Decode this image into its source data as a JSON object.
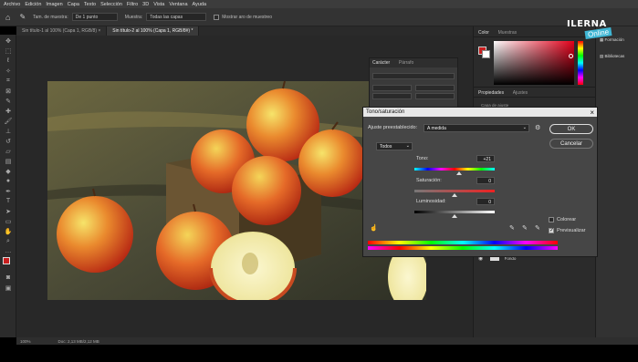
{
  "menubar": {
    "items": [
      "Archivo",
      "Edición",
      "Imagen",
      "Capa",
      "Texto",
      "Selección",
      "Filtro",
      "3D",
      "Vista",
      "Ventana",
      "Ayuda"
    ]
  },
  "options": {
    "sample_size_label": "Tam. de muestra:",
    "sample_size_value": "De 1 punto",
    "sample_label": "Muestra:",
    "sample_value": "Todas las capas",
    "show_ring_label": "Mostrar aro de muestreo"
  },
  "tabs": [
    {
      "label": "Sin título-1 al 100% (Capa 1, RGB/8) ×"
    },
    {
      "label": "Sin título-2 al 100% (Capa 1, RGB/8#) *"
    }
  ],
  "status": {
    "zoom": "100%",
    "doc": "Doc: 2,13 MB/2,12 MB"
  },
  "right_dock": {
    "color_tab": "Color",
    "swatches_tab": "Muestras",
    "properties_tab": "Propiedades",
    "adjustments_tab": "Ajustes",
    "adj_row": "Capa de ajuste",
    "layer_name": "Fondo"
  },
  "far_right": {
    "item1": "Formación",
    "item2": "Bibliotecas"
  },
  "logo": {
    "line1": "ILERNA",
    "line2": "Online"
  },
  "char_panel": {
    "tab1": "Carácter",
    "tab2": "Párrafo"
  },
  "dialog": {
    "title": "Tono/saturación",
    "close": "×",
    "preset_label": "Ajuste preestablecido:",
    "preset_value": "A medida",
    "channel_value": "Todos",
    "hue_label": "Tono:",
    "hue_value": "+21",
    "saturation_label": "Saturación:",
    "saturation_value": "0",
    "lightness_label": "Luminosidad:",
    "lightness_value": "0",
    "ok_label": "OK",
    "cancel_label": "Cancelar",
    "colorize_label": "Colorear",
    "preview_label": "Previsualizar",
    "hue_level": 0.555,
    "saturation_level": 0.5,
    "lightness_level": 0.5
  },
  "colors": {
    "accent": "#e8e8e8",
    "foreground": "#c81e1e",
    "logo": "#3fb6d4"
  }
}
